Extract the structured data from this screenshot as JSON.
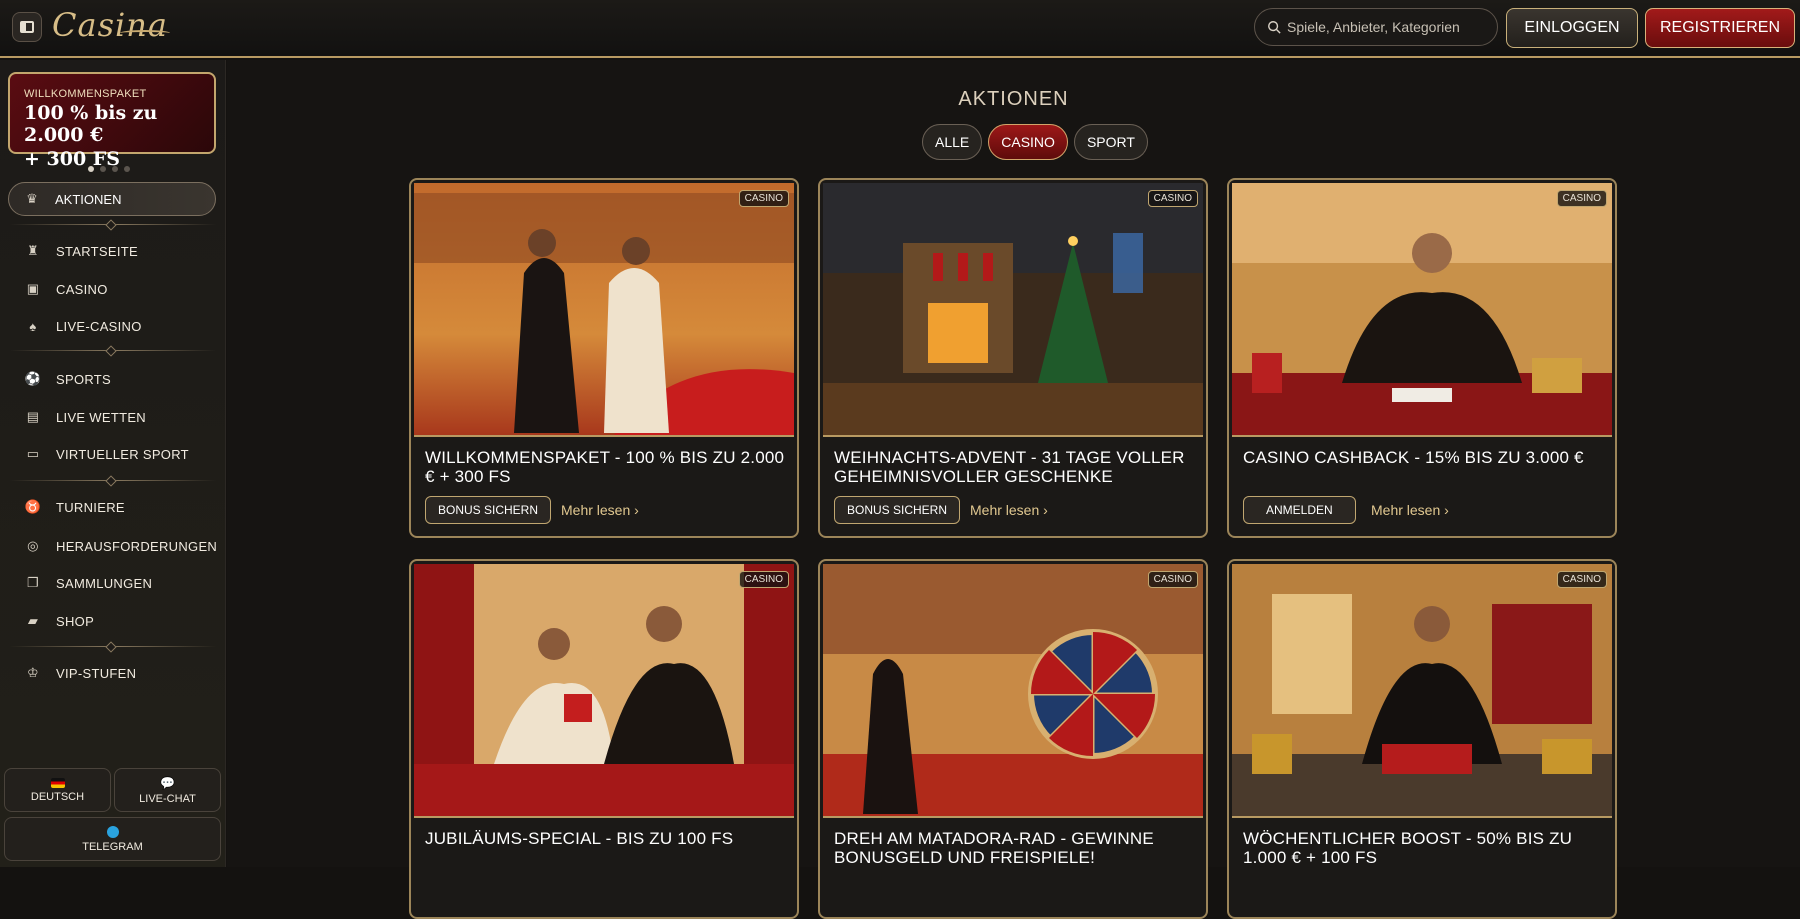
{
  "header": {
    "logo": "Casina",
    "search_placeholder": "Spiele, Anbieter, Kategorien",
    "login_label": "EINLOGGEN",
    "register_label": "REGISTRIEREN"
  },
  "sidebar": {
    "promo": {
      "small": "WILLKOMMENSPAKET",
      "line1": "100 % bis zu 2.000 €",
      "line2": "+ 300 FS"
    },
    "active": {
      "label": "AKTIONEN"
    },
    "groups": [
      [
        {
          "label": "STARTSEITE"
        },
        {
          "label": "CASINO"
        },
        {
          "label": "LIVE-CASINO"
        }
      ],
      [
        {
          "label": "SPORTS"
        },
        {
          "label": "LIVE WETTEN"
        },
        {
          "label": "VIRTUELLER SPORT"
        }
      ],
      [
        {
          "label": "TURNIERE"
        },
        {
          "label": "HERAUSFORDERUNGEN"
        },
        {
          "label": "SAMMLUNGEN"
        },
        {
          "label": "SHOP"
        }
      ],
      [
        {
          "label": "VIP-STUFEN"
        }
      ]
    ],
    "language_label": "DEUTSCH",
    "livechat_label": "LIVE-CHAT",
    "telegram_label": "TELEGRAM"
  },
  "main": {
    "title": "AKTIONEN",
    "filters": [
      {
        "label": "ALLE"
      },
      {
        "label": "CASINO"
      },
      {
        "label": "SPORT"
      }
    ],
    "cards": [
      {
        "badge": "CASINO",
        "title": "WILLKOMMENSPAKET - 100 % BIS ZU 2.000 € + 300 FS",
        "cta": "BONUS SICHERN",
        "more": "Mehr lesen ›"
      },
      {
        "badge": "CASINO",
        "title": "WEIHNACHTS-ADVENT - 31 TAGE VOLLER GEHEIMNISVOLLER GESCHENKE",
        "cta": "BONUS SICHERN",
        "more": "Mehr lesen ›"
      },
      {
        "badge": "CASINO",
        "title": "CASINO CASHBACK - 15% BIS ZU 3.000 €",
        "cta": "ANMELDEN",
        "more": "Mehr lesen ›"
      },
      {
        "badge": "CASINO",
        "title": "JUBILÄUMS-SPECIAL - BIS ZU 100 FS"
      },
      {
        "badge": "CASINO",
        "title": "DREH AM MATADORA-RAD - GEWINNE BONUSGELD UND FREISPIELE!"
      },
      {
        "badge": "CASINO",
        "title": "WÖCHENTLICHER BOOST - 50% BIS ZU 1.000 € + 100 FS"
      }
    ]
  }
}
